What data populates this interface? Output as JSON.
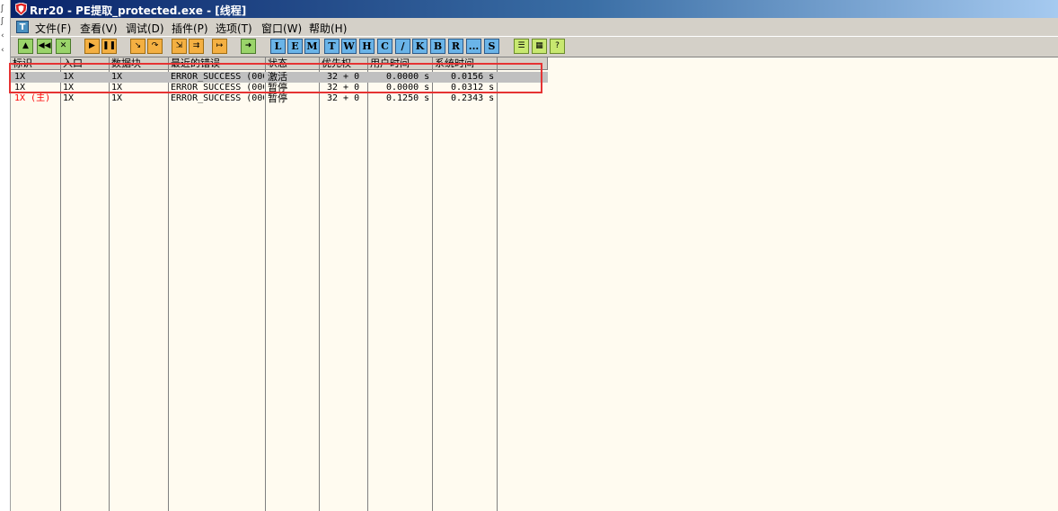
{
  "window": {
    "title": "Rrr20 - PE提取_protected.exe - [线程]",
    "title_bar_color": "#0a246a"
  },
  "menu": {
    "items": [
      "文件(F)",
      "查看(V)",
      "调试(D)",
      "插件(P)",
      "选项(T)",
      "窗口(W)",
      "帮助(H)"
    ]
  },
  "toolbar": {
    "buttons": [
      {
        "icon": "open-icon"
      },
      {
        "icon": "rewind-icon"
      },
      {
        "icon": "close-icon"
      },
      {
        "icon": "run-icon"
      },
      {
        "icon": "pause-icon"
      },
      {
        "icon": "step-into-icon"
      },
      {
        "icon": "step-over-icon"
      },
      {
        "icon": "trace-into-icon"
      },
      {
        "icon": "trace-over-icon"
      },
      {
        "icon": "execute-till-return-icon"
      },
      {
        "icon": "go-to-icon"
      }
    ],
    "letter_buttons": [
      "L",
      "E",
      "M",
      "T",
      "W",
      "H",
      "C",
      "/",
      "K",
      "B",
      "R",
      "...",
      "S"
    ],
    "extra_buttons": [
      {
        "icon": "list-icon"
      },
      {
        "icon": "grid-icon"
      },
      {
        "icon": "help-icon"
      }
    ]
  },
  "table": {
    "headers": [
      "标识",
      "入口",
      "数据块",
      "最近的错误",
      "状态",
      "优先权",
      "用户时间",
      "系统时间"
    ],
    "rows": [
      {
        "id": "1X",
        "entry": "1X",
        "data_block": "1X",
        "last_error": "ERROR_SUCCESS (000",
        "state": "激活",
        "priority": "32 + 0",
        "user_time": "0.0000 s",
        "system_time": "0.0156 s",
        "selected": true,
        "main": false
      },
      {
        "id": "1X",
        "entry": "1X",
        "data_block": "1X",
        "last_error": "ERROR_SUCCESS (000",
        "state": "暂停",
        "priority": "32 + 0",
        "user_time": "0.0000 s",
        "system_time": "0.0312 s",
        "selected": false,
        "main": false
      },
      {
        "id": "1X (主)",
        "entry": "1X",
        "data_block": "1X",
        "last_error": "ERROR_SUCCESS (000",
        "state": "暂停",
        "priority": "32 + 0",
        "user_time": "0.1250 s",
        "system_time": "0.2343 s",
        "selected": false,
        "main": true
      }
    ],
    "main_thread_color": "#ff0000",
    "selected_row_color": "#c0c0c0"
  },
  "annotation": {
    "color": "#e53333"
  }
}
